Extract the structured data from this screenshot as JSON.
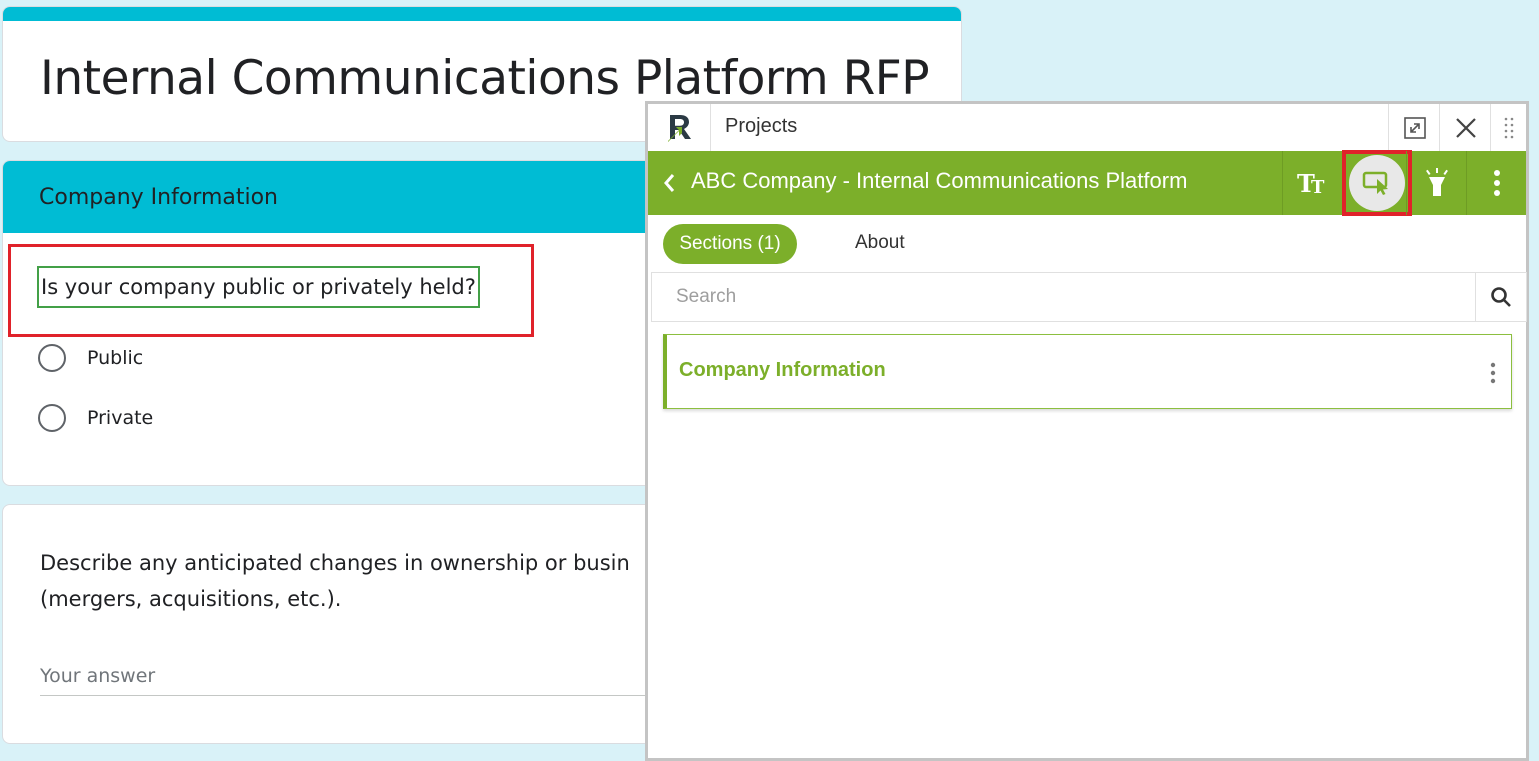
{
  "form": {
    "title": "Internal Communications Platform RFP",
    "section_title": "Company Information",
    "question1": {
      "text": "Is your company public or privately held?",
      "options": [
        "Public",
        "Private"
      ]
    },
    "question2": {
      "text_line1": "Describe any anticipated changes in ownership or busin",
      "text_line2": "(mergers, acquisitions, etc.).",
      "answer_placeholder": "Your answer"
    }
  },
  "panel": {
    "top_label": "Projects",
    "project_title": "ABC Company - Internal Communications Platform",
    "tabs": {
      "sections": "Sections (1)",
      "about": "About"
    },
    "search_placeholder": "Search",
    "sections": [
      {
        "label": "Company Information"
      }
    ],
    "icons": {
      "logo": "r-logo-icon",
      "expand": "expand-icon",
      "close": "close-icon",
      "drag": "drag-handle-icon",
      "back": "chevron-left-icon",
      "text_size": "text-size-icon",
      "select_mode": "cursor-select-icon",
      "highlight": "flashlight-icon",
      "more": "more-vertical-icon",
      "search": "search-icon"
    },
    "colors": {
      "accent": "#7caf2a",
      "highlight_box": "#e0222a",
      "form_header": "#00bcd4"
    }
  }
}
